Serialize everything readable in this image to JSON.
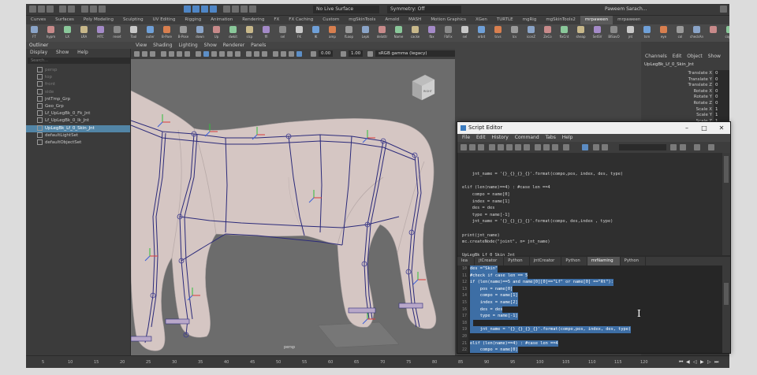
{
  "statusline": {
    "live_surface": "No Live Surface",
    "symmetry": "Symmetry: Off",
    "user": "Paweem Sarach..."
  },
  "shelf_tabs": [
    {
      "label": "Curves",
      "active": false
    },
    {
      "label": "Surfaces",
      "active": false
    },
    {
      "label": "Poly Modeling",
      "active": false
    },
    {
      "label": "Sculpting",
      "active": false
    },
    {
      "label": "UV Editing",
      "active": false
    },
    {
      "label": "Rigging",
      "active": false
    },
    {
      "label": "Animation",
      "active": false
    },
    {
      "label": "Rendering",
      "active": false
    },
    {
      "label": "FX",
      "active": false
    },
    {
      "label": "FX Caching",
      "active": false
    },
    {
      "label": "Custom",
      "active": false
    },
    {
      "label": "mgSkinTools",
      "active": false
    },
    {
      "label": "Arnold",
      "active": false
    },
    {
      "label": "MASH",
      "active": false
    },
    {
      "label": "Motion Graphics",
      "active": false
    },
    {
      "label": "XGen",
      "active": false
    },
    {
      "label": "TURTLE",
      "active": false
    },
    {
      "label": "mgRig",
      "active": false
    },
    {
      "label": "mgSkinTools2",
      "active": false
    },
    {
      "label": "mrpaween",
      "active": true
    },
    {
      "label": "mrpaween",
      "active": false
    }
  ],
  "shelf_icons": [
    "FT",
    "hypm",
    "LX",
    "LRA",
    "MTC",
    "reset",
    "Tool",
    "outer",
    "B-Pare",
    "B-Pose",
    "down",
    "Up",
    "dwkit",
    "slcp",
    "ffi",
    "sel",
    "FK",
    "IK",
    "amp",
    "fLoop",
    "Lepk",
    "delattr",
    "Name",
    "cacke",
    "fbx",
    "FbFix",
    "sel",
    "orbit",
    "tcvs",
    "lcv",
    "iconZ",
    "ZeCo",
    "fixCnt",
    "sheap",
    "SetSV",
    "BlSavO",
    "jnt",
    "tsm",
    "eye",
    "col",
    "checkAn",
    "",
    "copyS",
    "replace",
    "Opparts",
    "cons",
    "oppo",
    "shuffle",
    "cloots",
    "parkt",
    "",
    "PkTrn",
    "cloots",
    "parkt"
  ],
  "outliner": {
    "title": "Outliner",
    "menu": [
      "Display",
      "Show",
      "Help"
    ],
    "search_placeholder": "Search...",
    "rows": [
      {
        "label": "persp",
        "dim": true,
        "selected": false,
        "indent": 0
      },
      {
        "label": "top",
        "dim": true,
        "selected": false,
        "indent": 0
      },
      {
        "label": "front",
        "dim": true,
        "selected": false,
        "indent": 0
      },
      {
        "label": "side",
        "dim": true,
        "selected": false,
        "indent": 0
      },
      {
        "label": "jntTmp_Grp",
        "dim": false,
        "selected": false,
        "indent": 0
      },
      {
        "label": "Geo_Grp",
        "dim": false,
        "selected": false,
        "indent": 0
      },
      {
        "label": "Lf_UpLegBk_0_Fk_Jnt",
        "dim": false,
        "selected": false,
        "indent": 0
      },
      {
        "label": "Lf_UpLegBk_0_Ik_Jnt",
        "dim": false,
        "selected": false,
        "indent": 0
      },
      {
        "label": "UpLegBk_Lf_0_Skin_Jnt",
        "dim": false,
        "selected": true,
        "indent": 0
      },
      {
        "label": "defaultLightSet",
        "dim": false,
        "selected": false,
        "indent": 0
      },
      {
        "label": "defaultObjectSet",
        "dim": false,
        "selected": false,
        "indent": 0
      }
    ]
  },
  "viewport": {
    "menu": [
      "View",
      "Shading",
      "Lighting",
      "Show",
      "Renderer",
      "Panels"
    ],
    "num1": "0.00",
    "num2": "1.00",
    "colorspace": "sRGB gamma (legacy)",
    "camera_label": "persp",
    "viewcube_label": "RIGHT"
  },
  "channelbox": {
    "menu": [
      "Channels",
      "Edit",
      "Object",
      "Show"
    ],
    "node": "UpLegBk_Lf_0_Skin_Jnt",
    "attrs": [
      {
        "label": "Translate X",
        "value": "0"
      },
      {
        "label": "Translate Y",
        "value": "0"
      },
      {
        "label": "Translate Z",
        "value": "0"
      },
      {
        "label": "Rotate X",
        "value": "0"
      },
      {
        "label": "Rotate Y",
        "value": "0"
      },
      {
        "label": "Rotate Z",
        "value": "0"
      },
      {
        "label": "Scale X",
        "value": "1"
      },
      {
        "label": "Scale Y",
        "value": "1"
      },
      {
        "label": "Scale Z",
        "value": "1"
      }
    ]
  },
  "timeline": {
    "ticks": [
      "5",
      "10",
      "15",
      "20",
      "25",
      "30",
      "35",
      "40",
      "45",
      "50",
      "55",
      "60",
      "65",
      "70",
      "75",
      "80",
      "85",
      "90",
      "95",
      "100",
      "105",
      "110",
      "115",
      "120"
    ]
  },
  "script_editor": {
    "title": "Script Editor",
    "menu": [
      "File",
      "Edit",
      "History",
      "Command",
      "Tabs",
      "Help"
    ],
    "output_lines": [
      "",
      "",
      "    jnt_name = '{}_{}_{}_{}'.format(compo,pos, index, des, type)",
      "",
      "elif (len(name)==4) : #case len ==4",
      "    compo = name[0]",
      "    index = name[1]",
      "    des = des",
      "    type = name[-1]",
      "    jnt_name = '{}_{}_{}_{}'.format(compo, des,index , type)",
      "",
      "print(jnt_name)",
      "mc.createNode(\"joint\", n= jnt_name)",
      "",
      "UpLegBk_Lf_0_Skin_Jnt"
    ],
    "tabs": [
      {
        "label": "lea",
        "active": false
      },
      {
        "label": "jtCreator",
        "active": false
      },
      {
        "label": "Python",
        "active": false
      },
      {
        "label": "jntCreator",
        "active": false
      },
      {
        "label": "Python",
        "active": false
      },
      {
        "label": "mrNaming",
        "active": true
      },
      {
        "label": "Python",
        "active": false
      }
    ],
    "line_numbers": [
      "10",
      "11",
      "12",
      "13",
      "14",
      "15",
      "16",
      "17",
      "18",
      "19",
      "20",
      "21",
      "22"
    ],
    "input_lines": [
      {
        "text": "des =\"Skin\"",
        "hl": true
      },
      {
        "text": "#check if case len == 5",
        "hl": true
      },
      {
        "text": "if (len(name)==5 and name[0][0]==\"Lf\" or name[0] ==\"Rt\"):",
        "hl": true
      },
      {
        "text": "    pos = name[0]",
        "hl": true
      },
      {
        "text": "    compo = name[1]",
        "hl": true
      },
      {
        "text": "    index = name[2]",
        "hl": true
      },
      {
        "text": "    des = des",
        "hl": true
      },
      {
        "text": "    type = name[-1]",
        "hl": true
      },
      {
        "text": "",
        "hl": true
      },
      {
        "text": "    jnt_name = '{}_{}_{}_{}'.format(compo,pos, index, des, type)",
        "hl": true
      },
      {
        "text": "",
        "hl": false
      },
      {
        "text": "elif (len(name)==4) : #case len ==4",
        "hl": true
      },
      {
        "text": "    compo = name[0]",
        "hl": true
      }
    ]
  },
  "colors": {
    "accent": "#5285a6",
    "highlight": "#3d6ea5",
    "viewport_bg": "#6c6c6c"
  }
}
